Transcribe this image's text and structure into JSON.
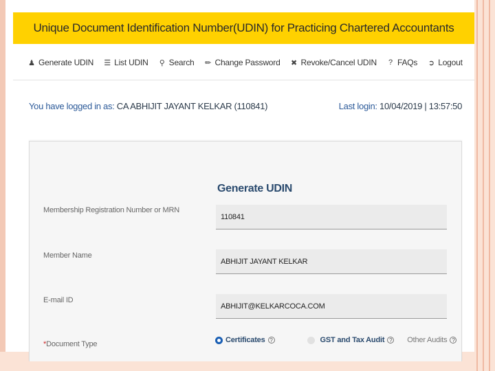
{
  "app": {
    "title": "Unique Document Identification Number(UDIN) for Practicing Chartered Accountants"
  },
  "nav": {
    "items": [
      {
        "label": "Generate UDIN",
        "icon": "user-plus-icon"
      },
      {
        "label": "List UDIN",
        "icon": "list-icon"
      },
      {
        "label": "Search",
        "icon": "search-icon"
      },
      {
        "label": "Change Password",
        "icon": "key-icon"
      },
      {
        "label": "Revoke/Cancel UDIN",
        "icon": "cancel-icon"
      },
      {
        "label": "FAQs",
        "icon": "help-icon"
      },
      {
        "label": "Logout",
        "icon": "logout-icon"
      }
    ]
  },
  "session": {
    "logged_in_label": "You have logged in as:",
    "user": "CA ABHIJIT JAYANT KELKAR (110841)",
    "last_login_label": "Last login:",
    "last_login_value": "10/04/2019 | 13:57:50"
  },
  "form": {
    "title": "Generate UDIN",
    "mrn_label": "Membership Registration Number or MRN",
    "mrn_value": "110841",
    "name_label": "Member Name",
    "name_value": "ABHIJIT JAYANT KELKAR",
    "email_label": "E-mail ID",
    "email_value": "ABHIJIT@KELKARCOCA.COM",
    "doc_type_required_mark": "*",
    "doc_type_label": "Document Type",
    "doc_types": [
      {
        "label": "Certificates",
        "selected": true
      },
      {
        "label": "GST and Tax Audit",
        "selected": false
      },
      {
        "label": "Other Audits",
        "selected": false
      }
    ]
  },
  "colors": {
    "banner": "#ffd100",
    "accent_blue": "#2c5a99",
    "required_red": "#cc2222",
    "frame": "#fbe3d6"
  }
}
